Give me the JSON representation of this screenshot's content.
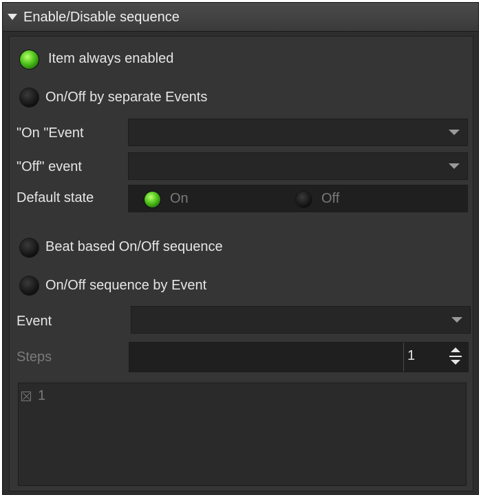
{
  "panel": {
    "title": "Enable/Disable sequence"
  },
  "options": {
    "always_enabled": "Item always enabled",
    "separate_events": "On/Off by separate Events",
    "beat_based": "Beat based On/Off sequence",
    "sequence_by_event": "On/Off sequence by Event",
    "selected": "always_enabled"
  },
  "separate_events": {
    "on_event_label": "\"On \"Event",
    "on_event_value": "",
    "off_event_label": "\"Off\" event",
    "off_event_value": "",
    "default_state_label": "Default state",
    "default_on_label": "On",
    "default_off_label": "Off",
    "default_selected": "On"
  },
  "sequence_event": {
    "event_label": "Event",
    "event_value": "",
    "steps_label": "Steps",
    "steps_value": "1"
  },
  "steps_list": {
    "items": [
      {
        "label": "1"
      }
    ]
  },
  "colors": {
    "radio_on": "#4cc21a",
    "panel_bg": "#353535"
  },
  "icons": {
    "collapse": "triangle-down-icon",
    "dropdown": "chevron-down-icon",
    "spin": "spin-arrows-icon",
    "step_checkbox": "x-box-icon"
  }
}
